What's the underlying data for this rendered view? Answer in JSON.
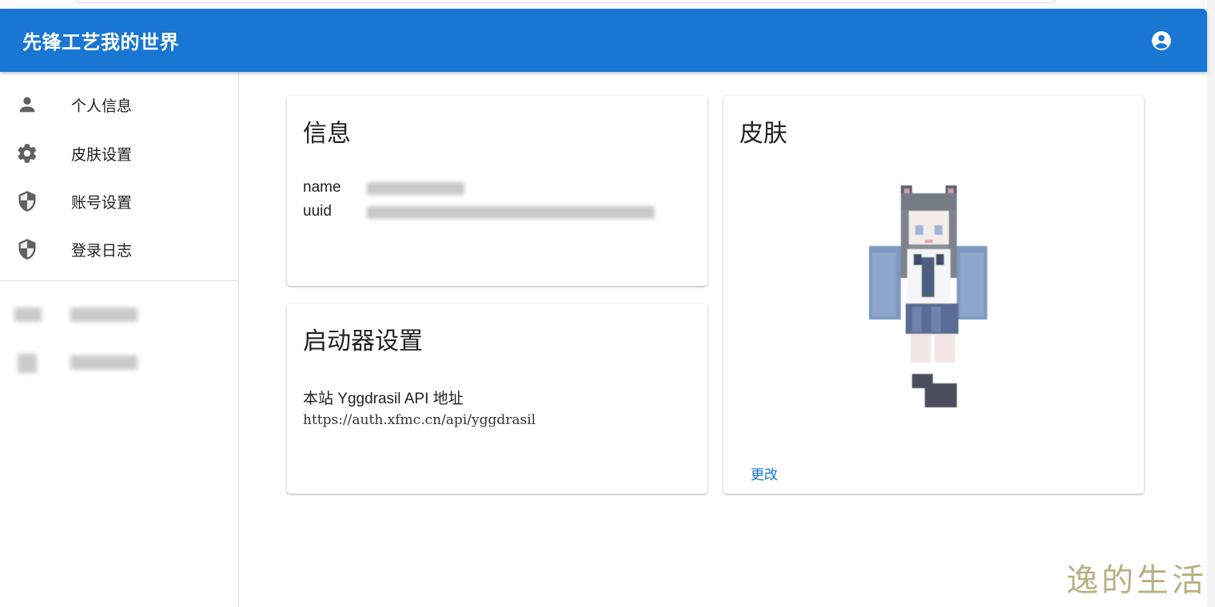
{
  "app": {
    "title": "先锋工艺我的世界"
  },
  "header": {
    "account_icon": "account-circle-icon"
  },
  "sidebar": {
    "items": [
      {
        "label": "个人信息",
        "icon": "person-icon"
      },
      {
        "label": "皮肤设置",
        "icon": "gear-icon"
      },
      {
        "label": "账号设置",
        "icon": "shield-icon"
      },
      {
        "label": "登录日志",
        "icon": "shield-icon"
      }
    ]
  },
  "info_card": {
    "title": "信息",
    "rows": [
      {
        "key": "name"
      },
      {
        "key": "uuid"
      }
    ]
  },
  "launcher_card": {
    "title": "启动器设置",
    "label": "本站 Yggdrasil API 地址",
    "url": "https://auth.xfmc.cn/api/yggdrasil"
  },
  "skin_card": {
    "title": "皮肤",
    "change_label": "更改"
  },
  "watermark": "逸的生活",
  "colors": {
    "primary": "#1976d2",
    "icon_gray": "#616161"
  }
}
